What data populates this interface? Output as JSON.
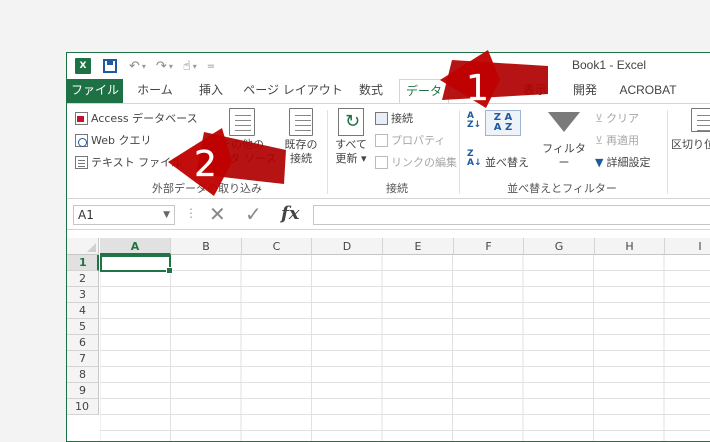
{
  "window": {
    "title": "Book1 - Excel",
    "qat": {
      "logo": "X",
      "undo": "↶",
      "redo": "↷",
      "touch": "☝",
      "customize": "₹"
    }
  },
  "tabs": [
    {
      "label": "ファイル"
    },
    {
      "label": "ホーム"
    },
    {
      "label": "挿入"
    },
    {
      "label": "ページ レイアウト"
    },
    {
      "label": "数式"
    },
    {
      "label": "データ"
    },
    {
      "label": "表示"
    },
    {
      "label": "開発"
    },
    {
      "label": "ACROBAT"
    }
  ],
  "ribbon": {
    "get_external_data": {
      "label": "外部データの取り込み",
      "access": "Access データベース",
      "web": "Web クエリ",
      "text": "テキスト ファイル",
      "other_line1": "その他の",
      "other_line2": "データ ソース",
      "existing_line1": "既存の",
      "existing_line2": "接続"
    },
    "connections": {
      "label": "接続",
      "refresh_line1": "すべて",
      "refresh_line2": "更新",
      "connections": "接続",
      "properties": "プロパティ",
      "edit_links": "リンクの編集"
    },
    "sort_filter": {
      "label": "並べ替えとフィルター",
      "sort": "並べ替え",
      "filter": "フィルター",
      "clear": "クリア",
      "reapply": "再適用",
      "advanced": "詳細設定"
    },
    "data_tools": {
      "text_to_columns": "区切り位置"
    }
  },
  "formula_bar": {
    "name_box": "A1",
    "cancel": "✕",
    "enter": "✓",
    "fx": "fx",
    "value": ""
  },
  "columns": [
    "A",
    "B",
    "C",
    "D",
    "E",
    "F",
    "G",
    "H",
    "I"
  ],
  "rows": [
    "1",
    "2",
    "3",
    "4",
    "5",
    "6",
    "7",
    "8",
    "9",
    "10"
  ],
  "annotations": [
    {
      "number": "1",
      "color": "#c00000"
    },
    {
      "number": "2",
      "color": "#c00000"
    }
  ],
  "colors": {
    "excel_green": "#1e7145",
    "selection": "#217346",
    "arrow_red": "#c00000"
  }
}
